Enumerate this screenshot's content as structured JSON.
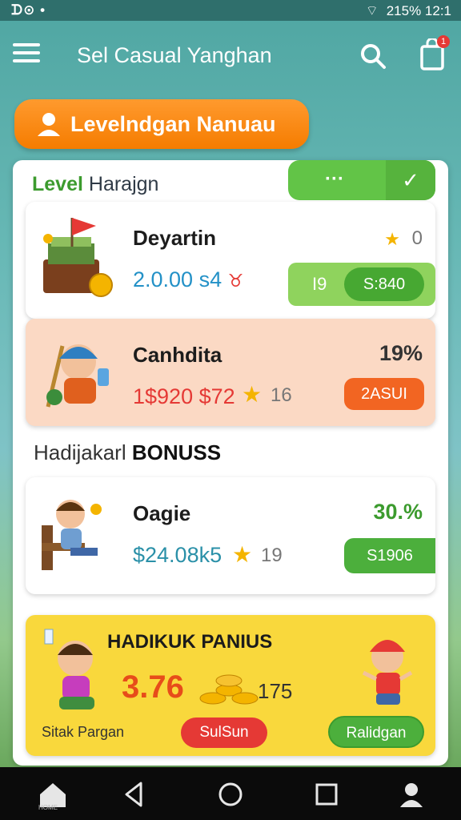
{
  "status_bar": {
    "left": "ᗪ⊙ •",
    "right": "215% 12:1"
  },
  "header": {
    "title": "Sel Casual Yanghan"
  },
  "level_pill": {
    "label": "Levelndgan Nanuau"
  },
  "panel": {
    "title_green": "Level",
    "title_rest": " Harajgn",
    "toggle_dots": "···",
    "toggle_check": "✓"
  },
  "cards": [
    {
      "name": "Deyartin",
      "amount": "2.0.00 s4",
      "right_value": "0",
      "btn_left": "I9",
      "btn_right": "S:840"
    },
    {
      "name": "Canhdita",
      "amount": "1$920 $72",
      "stars_count": "16",
      "right_value": "19%",
      "btn": "2ASUI"
    },
    {
      "name": "Oagie",
      "amount": "$24.08k5",
      "stars_count": "19",
      "right_value": "30.%",
      "btn": "S1906"
    }
  ],
  "section": {
    "heading_plain": "Hadijakarl ",
    "heading_bold": "BONUSS"
  },
  "promo": {
    "title": "HADIKUK PANIUS",
    "amount": "3.76",
    "count": "175",
    "caption": "Sitak Pargan",
    "btn_red": "SulSun",
    "btn_green": "Ralidgan"
  },
  "nav": {
    "home_label": "HOME"
  },
  "colors": {
    "accent_orange": "#f57c00",
    "accent_green": "#4caf3c",
    "promo_yellow": "#f9d83c"
  }
}
